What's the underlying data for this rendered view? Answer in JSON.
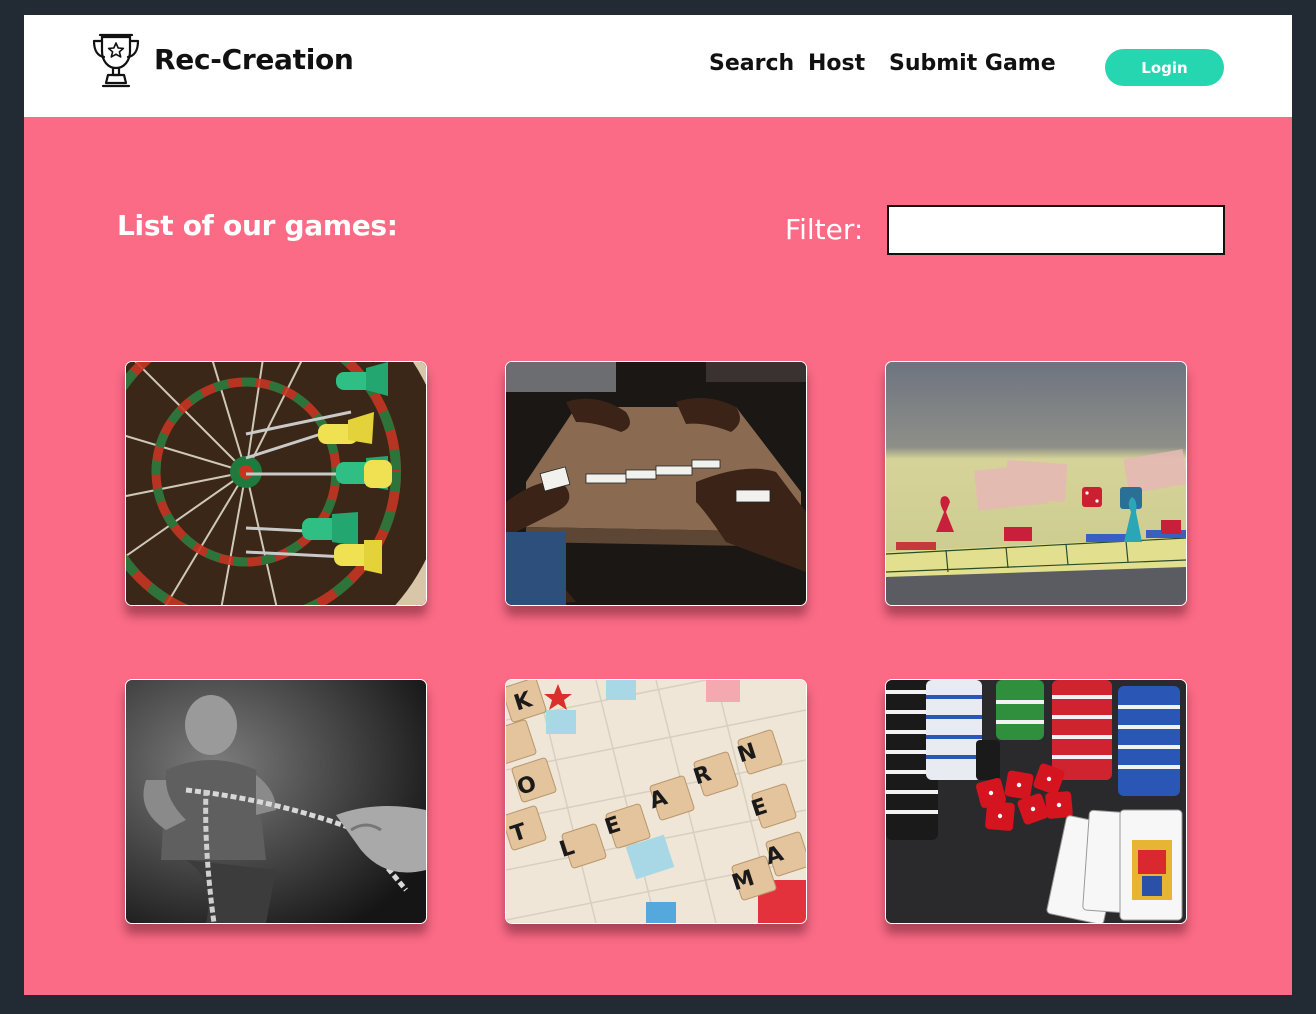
{
  "brand": {
    "name": "Rec-Creation",
    "logo_icon": "trophy-icon"
  },
  "nav": {
    "links": [
      "Search",
      "Host",
      "Submit Game"
    ],
    "login_label": "Login"
  },
  "main": {
    "heading": "List of our games:",
    "filter_label": "Filter:",
    "filter_value": ""
  },
  "games": [
    {
      "image": "darts-dartboard-photo"
    },
    {
      "image": "dominoes-table-photo"
    },
    {
      "image": "monopoly-board-photo"
    },
    {
      "image": "tug-of-war-photo"
    },
    {
      "image": "scrabble-tiles-photo",
      "tiles": [
        "L",
        "E",
        "A",
        "R",
        "N"
      ]
    },
    {
      "image": "poker-chips-dice-cards-photo"
    }
  ],
  "colors": {
    "page_background": "#fb6b86",
    "navbar_background": "#ffffff",
    "accent": "#26d6b0",
    "outer_background": "#222b33"
  }
}
